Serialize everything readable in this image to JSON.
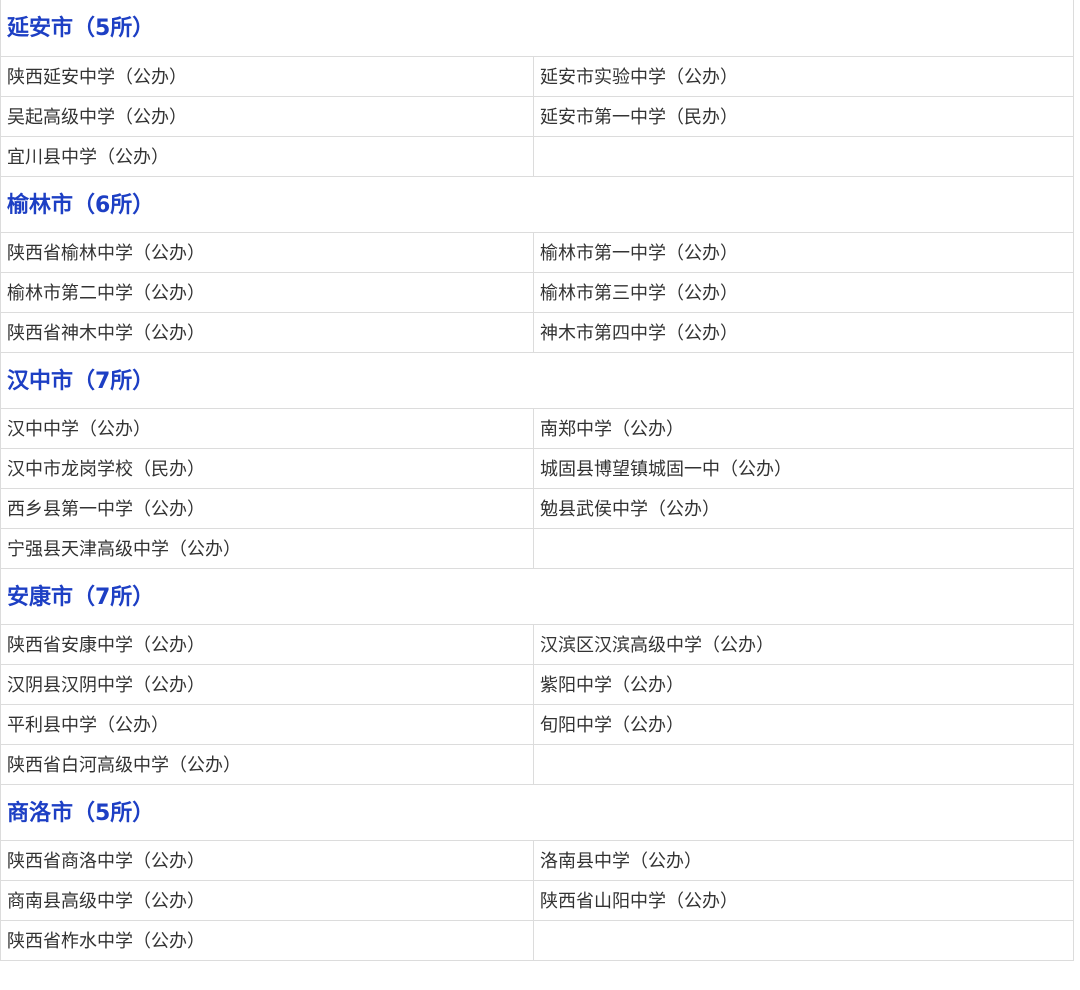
{
  "sections": [
    {
      "city": "延安市（5所）",
      "rows": [
        [
          "陕西延安中学（公办）",
          "延安市实验中学（公办）"
        ],
        [
          "吴起高级中学（公办）",
          "延安市第一中学（民办）"
        ],
        [
          "宜川县中学（公办）",
          ""
        ]
      ]
    },
    {
      "city": "榆林市（6所）",
      "rows": [
        [
          "陕西省榆林中学（公办）",
          "榆林市第一中学（公办）"
        ],
        [
          "榆林市第二中学（公办）",
          "榆林市第三中学（公办）"
        ],
        [
          "陕西省神木中学（公办）",
          "神木市第四中学（公办）"
        ]
      ]
    },
    {
      "city": "汉中市（7所）",
      "rows": [
        [
          "汉中中学（公办）",
          "南郑中学（公办）"
        ],
        [
          "汉中市龙岗学校（民办）",
          "城固县博望镇城固一中（公办）"
        ],
        [
          "西乡县第一中学（公办）",
          "勉县武侯中学（公办）"
        ],
        [
          "宁强县天津高级中学（公办）",
          ""
        ]
      ]
    },
    {
      "city": "安康市（7所）",
      "rows": [
        [
          "陕西省安康中学（公办）",
          "汉滨区汉滨高级中学（公办）"
        ],
        [
          "汉阴县汉阴中学（公办）",
          "紫阳中学（公办）"
        ],
        [
          "平利县中学（公办）",
          "旬阳中学（公办）"
        ],
        [
          "陕西省白河高级中学（公办）",
          ""
        ]
      ]
    },
    {
      "city": "商洛市（5所）",
      "rows": [
        [
          "陕西省商洛中学（公办）",
          "洛南县中学（公办）"
        ],
        [
          "商南县高级中学（公办）",
          "陕西省山阳中学（公办）"
        ],
        [
          "陕西省柞水中学（公办）",
          ""
        ]
      ]
    }
  ]
}
